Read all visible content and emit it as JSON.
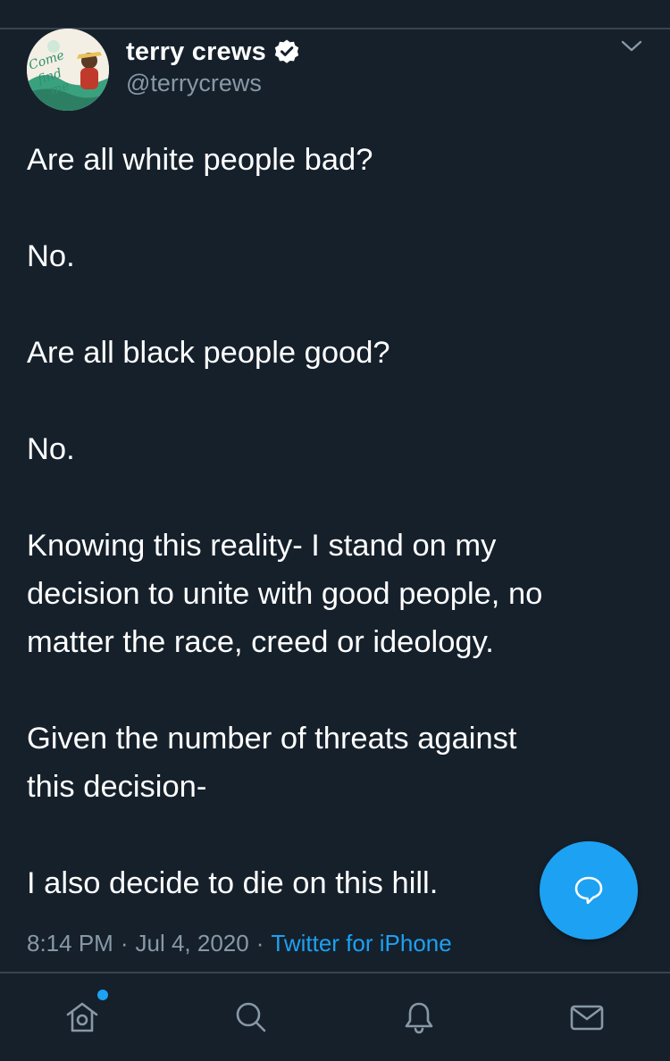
{
  "tweet": {
    "author": {
      "display_name": "terry crews",
      "handle": "@terrycrews",
      "verified": true,
      "avatar_text": "Come find me"
    },
    "paragraphs": [
      "Are all white people bad?",
      "No.",
      "Are all black people good?",
      "No.",
      "Knowing this reality- I stand on my\ndecision to unite with good people, no\nmatter the race, creed or ideology.",
      "Given the number of threats against\nthis decision-",
      "I also decide to die on this hill."
    ],
    "meta": {
      "time": "8:14 PM",
      "date": "Jul 4, 2020",
      "separator": "·",
      "source": "Twitter for iPhone"
    }
  },
  "actions": {
    "compose_icon": "speech-bubble-icon",
    "more_icon": "chevron-down-icon"
  },
  "tabbar": {
    "items": [
      {
        "name": "home",
        "icon": "home-icon",
        "has_unread": true
      },
      {
        "name": "search",
        "icon": "search-icon",
        "has_unread": false
      },
      {
        "name": "notifications",
        "icon": "bell-icon",
        "has_unread": false
      },
      {
        "name": "messages",
        "icon": "envelope-icon",
        "has_unread": false
      }
    ]
  },
  "colors": {
    "background": "#15202b",
    "divider": "#38444d",
    "text_primary": "#ffffff",
    "text_secondary": "#8899a6",
    "accent": "#1da1f2"
  }
}
